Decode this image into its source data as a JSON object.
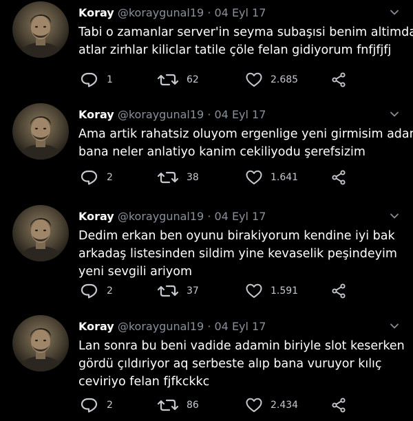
{
  "tweets": [
    {
      "name": "Koray",
      "handle": "@koraygunal19",
      "sep": "·",
      "date": "04 Eyl 17",
      "lines": [
        "Tabi o zamanlar server'in seyma subaşısi benim altimda",
        "atlar zirhlar kiliclar tatile çöle felan gidiyorum fnfjfjfj"
      ],
      "replies": "1",
      "retweets": "62",
      "likes": "2.685"
    },
    {
      "name": "Koray",
      "handle": "@koraygunal19",
      "sep": "·",
      "date": "04 Eyl 17",
      "lines": [
        "Ama artik rahatsiz oluyom ergenlige yeni girmisim adam",
        "bana neler anlatiyo kanim cekiliyodu şerefsizim"
      ],
      "replies": "2",
      "retweets": "38",
      "likes": "1.641"
    },
    {
      "name": "Koray",
      "handle": "@koraygunal19",
      "sep": "·",
      "date": "04 Eyl 17",
      "lines": [
        "Dedim erkan ben oyunu birakiyorum kendine iyi bak",
        "arkadaş listesinden sildim yine kevaselik peşindeyim",
        "yeni sevgili ariyom"
      ],
      "replies": "2",
      "retweets": "37",
      "likes": "1.591"
    },
    {
      "name": "Koray",
      "handle": "@koraygunal19",
      "sep": "·",
      "date": "04 Eyl 17",
      "lines": [
        "Lan sonra bu beni vadide adamin biriyle slot keserken",
        "gördü çıldıriyor aq serbeste alıp bana vuruyor kılıç",
        "ceviriyo felan fjfkckkc"
      ],
      "replies": "2",
      "retweets": "86",
      "likes": "2.434"
    }
  ],
  "icons": {
    "reply": "reply-icon",
    "retweet": "retweet-icon",
    "like": "heart-icon",
    "share": "share-icon",
    "menu": "chevron-down-icon"
  },
  "colors": {
    "background": "#000000",
    "text": "#ffffff",
    "muted": "#8a9099",
    "icon": "#c5c9cf"
  }
}
